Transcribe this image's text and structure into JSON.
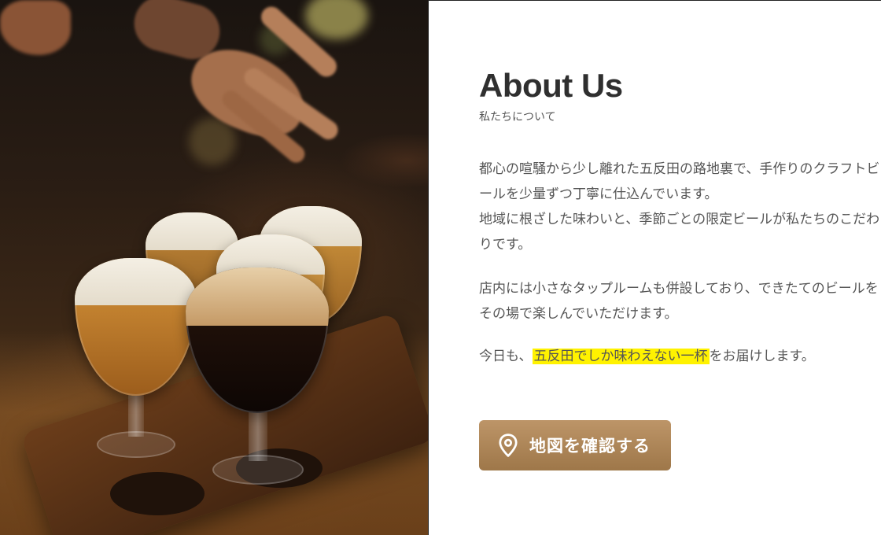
{
  "photo": {
    "icon": "beer-flight-photo"
  },
  "about": {
    "title": "About Us",
    "subtitle": "私たちについて",
    "paragraph1": {
      "line1": "都心の喧騒から少し離れた五反田の路地裏で、手作りのクラフトビールを少量ずつ丁寧に仕込んでいます。",
      "line2": "地域に根ざした味わいと、季節ごとの限定ビールが私たちのこだわりです。"
    },
    "paragraph2": "店内には小さなタップルームも併設しており、できたてのビールをその場で楽しんでいただけます。",
    "paragraph3": {
      "before": "今日も、",
      "highlight": "五反田でしか味わえない一杯",
      "after": "をお届けします。"
    }
  },
  "map_button": {
    "label": "地図を確認する",
    "icon": "map-pin-icon"
  },
  "colors": {
    "highlight": "#fff200",
    "button_top": "#bd9568",
    "button_bottom": "#9e7749",
    "heading": "#2f2f2f",
    "body_text": "#555555"
  }
}
